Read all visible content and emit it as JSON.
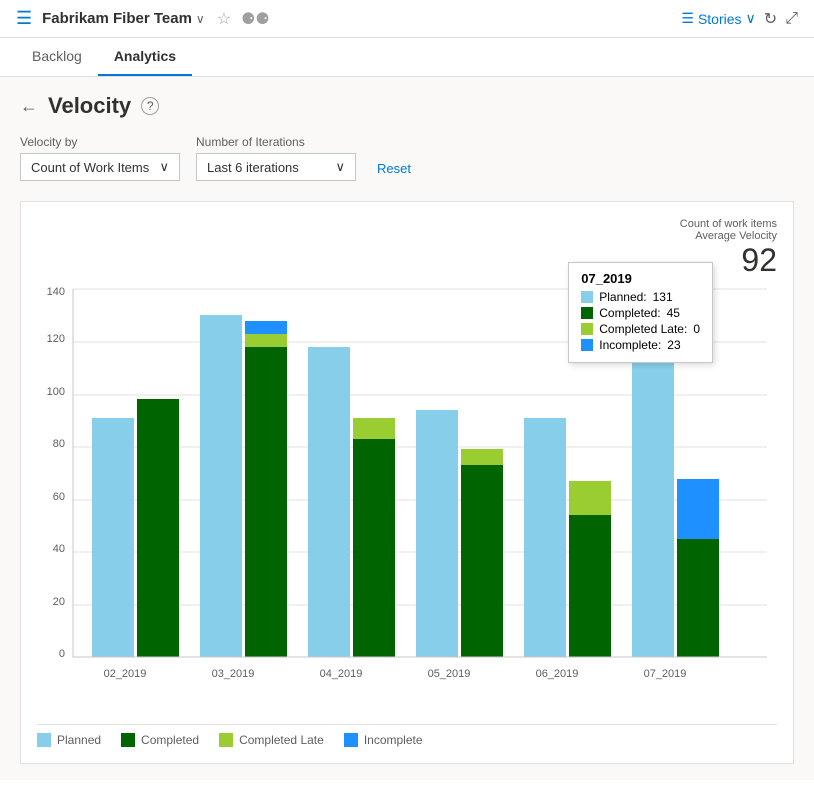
{
  "header": {
    "icon": "☰",
    "team_name": "Fabrikam Fiber Team",
    "chevron": "∨",
    "star": "☆",
    "team_members_icon": "👥",
    "stories_label": "Stories",
    "stories_chevron": "∨"
  },
  "nav": {
    "tabs": [
      {
        "id": "backlog",
        "label": "Backlog",
        "active": false
      },
      {
        "id": "analytics",
        "label": "Analytics",
        "active": true
      }
    ]
  },
  "page": {
    "back_label": "←",
    "title": "Velocity",
    "help_label": "?",
    "velocity_by_label": "Velocity by",
    "velocity_by_value": "Count of Work Items",
    "iterations_label": "Number of Iterations",
    "iterations_value": "Last 6 iterations",
    "reset_label": "Reset"
  },
  "chart": {
    "summary_label": "Count of work items",
    "avg_label": "Average Velocity",
    "avg_value": "92",
    "y_axis": [
      0,
      20,
      40,
      60,
      80,
      100,
      120,
      140
    ],
    "colors": {
      "planned": "#87CEEB",
      "completed": "#006400",
      "completed_late": "#9ACD32",
      "incomplete": "#1E90FF"
    },
    "bars": [
      {
        "label": "02_2019",
        "planned": 91,
        "completed": 98,
        "completed_late": 0,
        "incomplete": 0
      },
      {
        "label": "03_2019",
        "planned": 130,
        "completed": 118,
        "completed_late": 5,
        "incomplete": 5
      },
      {
        "label": "04_2019",
        "planned": 118,
        "completed": 83,
        "completed_late": 8,
        "incomplete": 0
      },
      {
        "label": "05_2019",
        "planned": 94,
        "completed": 73,
        "completed_late": 6,
        "incomplete": 0
      },
      {
        "label": "06_2019",
        "planned": 91,
        "completed": 54,
        "completed_late": 13,
        "incomplete": 0
      },
      {
        "label": "07_2019",
        "planned": 131,
        "completed": 45,
        "completed_late": 0,
        "incomplete": 23
      }
    ],
    "tooltip": {
      "title": "07_2019",
      "planned_label": "Planned:",
      "planned_value": "131",
      "completed_label": "Completed:",
      "completed_value": "45",
      "completed_late_label": "Completed Late:",
      "completed_late_value": "0",
      "incomplete_label": "Incomplete:",
      "incomplete_value": "23"
    },
    "legend": [
      {
        "id": "planned",
        "label": "Planned",
        "color": "#87CEEB"
      },
      {
        "id": "completed",
        "label": "Completed",
        "color": "#006400"
      },
      {
        "id": "completed-late",
        "label": "Completed Late",
        "color": "#9ACD32"
      },
      {
        "id": "incomplete",
        "label": "Incomplete",
        "color": "#1E90FF"
      }
    ]
  }
}
